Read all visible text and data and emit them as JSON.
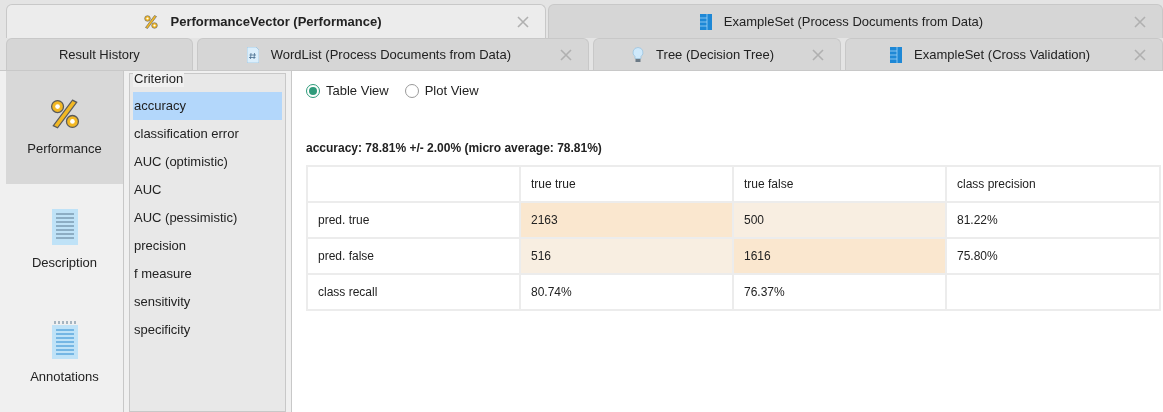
{
  "tab_rows": [
    [
      {
        "label": "PerformanceVector (Performance)",
        "kind": "performance",
        "selected": true
      },
      {
        "label": "ExampleSet (Process Documents from Data)",
        "kind": "exampleset",
        "selected": false
      }
    ],
    [
      {
        "label": "Result History",
        "kind": "history",
        "selected": false
      },
      {
        "label": "WordList (Process Documents from Data)",
        "kind": "wordlist",
        "selected": false
      },
      {
        "label": "Tree (Decision Tree)",
        "kind": "tree",
        "selected": false
      },
      {
        "label": "ExampleSet (Cross Validation)",
        "kind": "exampleset",
        "selected": false
      }
    ]
  ],
  "side_nav": [
    {
      "label": "Performance",
      "kind": "performance",
      "selected": true
    },
    {
      "label": "Description",
      "kind": "description",
      "selected": false
    },
    {
      "label": "Annotations",
      "kind": "annotations",
      "selected": false
    }
  ],
  "criterion": {
    "title": "Criterion",
    "items": [
      {
        "label": "accuracy",
        "selected": true
      },
      {
        "label": "classification error",
        "selected": false
      },
      {
        "label": "AUC (optimistic)",
        "selected": false
      },
      {
        "label": "AUC",
        "selected": false
      },
      {
        "label": "AUC (pessimistic)",
        "selected": false
      },
      {
        "label": "precision",
        "selected": false
      },
      {
        "label": "f measure",
        "selected": false
      },
      {
        "label": "sensitivity",
        "selected": false
      },
      {
        "label": "specificity",
        "selected": false
      }
    ]
  },
  "view_options": [
    {
      "label": "Table View",
      "selected": true
    },
    {
      "label": "Plot View",
      "selected": false
    }
  ],
  "summary": "accuracy: 78.81% +/- 2.00% (micro average: 78.81%)",
  "table": {
    "columns": [
      "",
      "true true",
      "true false",
      "class precision"
    ],
    "rows": [
      [
        {
          "text": "pred. true",
          "kind": "plain"
        },
        {
          "text": "2163",
          "kind": "strong"
        },
        {
          "text": "500",
          "kind": "weak"
        },
        {
          "text": "81.22%",
          "kind": "plain"
        }
      ],
      [
        {
          "text": "pred. false",
          "kind": "plain"
        },
        {
          "text": "516",
          "kind": "weak"
        },
        {
          "text": "1616",
          "kind": "strong"
        },
        {
          "text": "75.80%",
          "kind": "plain"
        }
      ],
      [
        {
          "text": "class recall",
          "kind": "plain"
        },
        {
          "text": "80.74%",
          "kind": "plain"
        },
        {
          "text": "76.37%",
          "kind": "plain"
        },
        {
          "text": "",
          "kind": "plain"
        }
      ]
    ]
  }
}
